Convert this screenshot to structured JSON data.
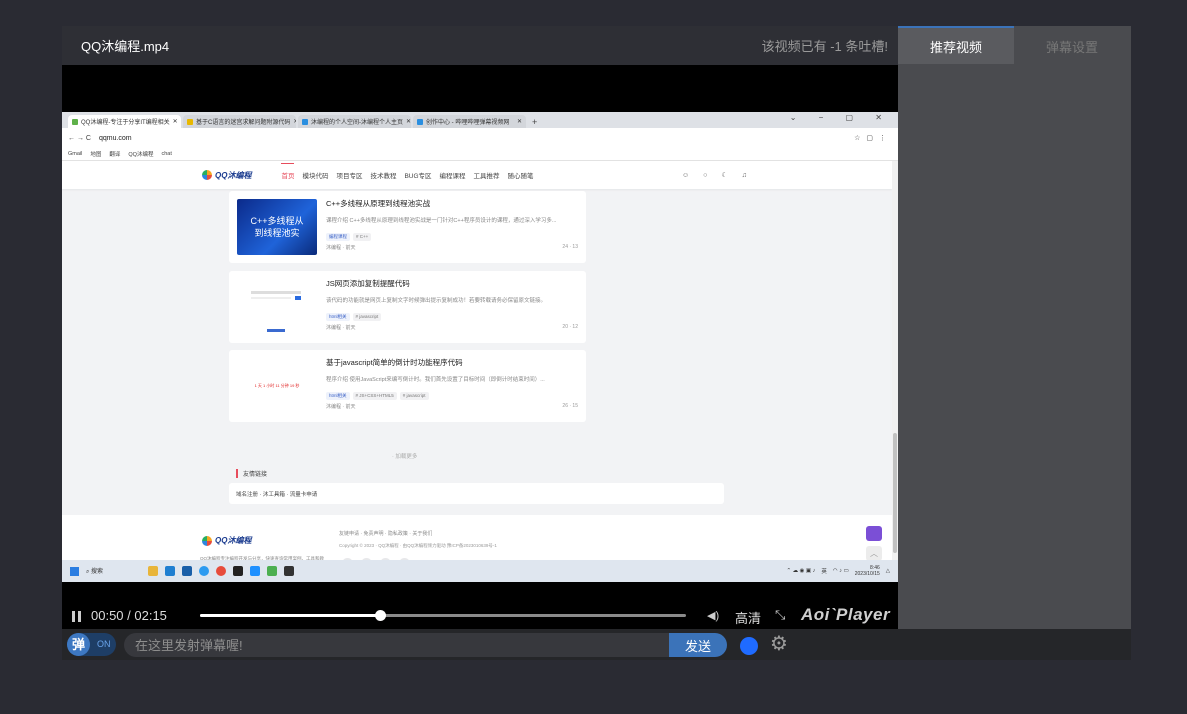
{
  "player": {
    "title": "QQ沐编程.mp4",
    "danmaku_count_text": "该视频已有 -1 条吐槽!"
  },
  "screen": {
    "browser_tabs": [
      {
        "label": "QQ沐编程-专注于分享IT编程相关",
        "color": "#5fb14a"
      },
      {
        "label": "基于C语言的迷宫求解问题附源代码",
        "color": "#e8b800"
      },
      {
        "label": "沐编程的个人空间-沐编程个人主页",
        "color": "#2a8fe0"
      },
      {
        "label": "创作中心 - 哔哩哔哩弹幕视频网",
        "color": "#2a8fe0"
      }
    ],
    "new_tab": "+",
    "url": "qqmu.com",
    "bookmarks": [
      "Gmail",
      "地图",
      "翻译",
      "QQ沐编程",
      "chat"
    ],
    "site_logo": "QQ沐编程",
    "nav": [
      "首页",
      "模块代码",
      "项目专区",
      "技术教程",
      "BUG专区",
      "编程课程",
      "工具推荐",
      "随心随笔"
    ],
    "cards": [
      {
        "thumb_text": "C++多线程从\n到线程池实",
        "title": "C++多线程从原理到线程池实战",
        "desc": "课程介绍 C++多线程从原理到线程池实战是一门针对C++程序员设计的课程，通过深入学习多...",
        "tags": [
          "编程课程",
          "# C++"
        ],
        "author": "沐编程 · 前天",
        "stats": "24 · 13"
      },
      {
        "thumb_text": "",
        "title": "JS网页添加复制提醒代码",
        "desc": "该代码的功能就是网页上复制文字时候弹出提示复制成功！若要转载请务必保留原文链接。",
        "tags": [
          "html相关",
          "# javascript"
        ],
        "author": "沐编程 · 前天",
        "stats": "20 · 12"
      },
      {
        "thumb_text": "1 天 1 小时 11 分钟 19 秒",
        "title": "基于javascript简单的倒计时功能程序代码",
        "desc": "程序介绍 使用JavaScript来编写倒计时。我们首先设置了目标时间（即倒计时结束时间）...",
        "tags": [
          "html相关",
          "# JS+CSS+HTML5",
          "# javascript"
        ],
        "author": "沐编程 · 前天",
        "stats": "26 · 15"
      }
    ],
    "load_more": "· 加载更多",
    "friend_links_title": "友情链接",
    "friend_links": "域名注册 · 沐工具箱 · 流量卡申请",
    "footer_logo": "QQ沐编程",
    "footer_desc": "QQ沐编程专注编程开发与分享，快速查询常用案例、工具和教程，bug解决方案",
    "footer_links": "友链申请 · 免责声明 · 隐私政策 · 关于我们",
    "footer_copy": "Copyright © 2023 · QQ沐编程 · 由QQ沐编程倾力驱动 豫ICP备2023010639号-1",
    "taskbar_search": "搜索",
    "tray_lang": "英",
    "clock_time": "8:46",
    "clock_date": "2023/10/15"
  },
  "controls": {
    "time": "00:50 / 02:15",
    "progress": 0.37,
    "quality": "高清",
    "brand": "Aoi`Player"
  },
  "danmaku": {
    "label": "弹",
    "on_text": "ON",
    "placeholder": "在这里发射弹幕喔!",
    "send": "发送",
    "color": "#1f6bff"
  },
  "sidebar": {
    "tabs": [
      "推荐视频",
      "弹幕设置"
    ]
  }
}
